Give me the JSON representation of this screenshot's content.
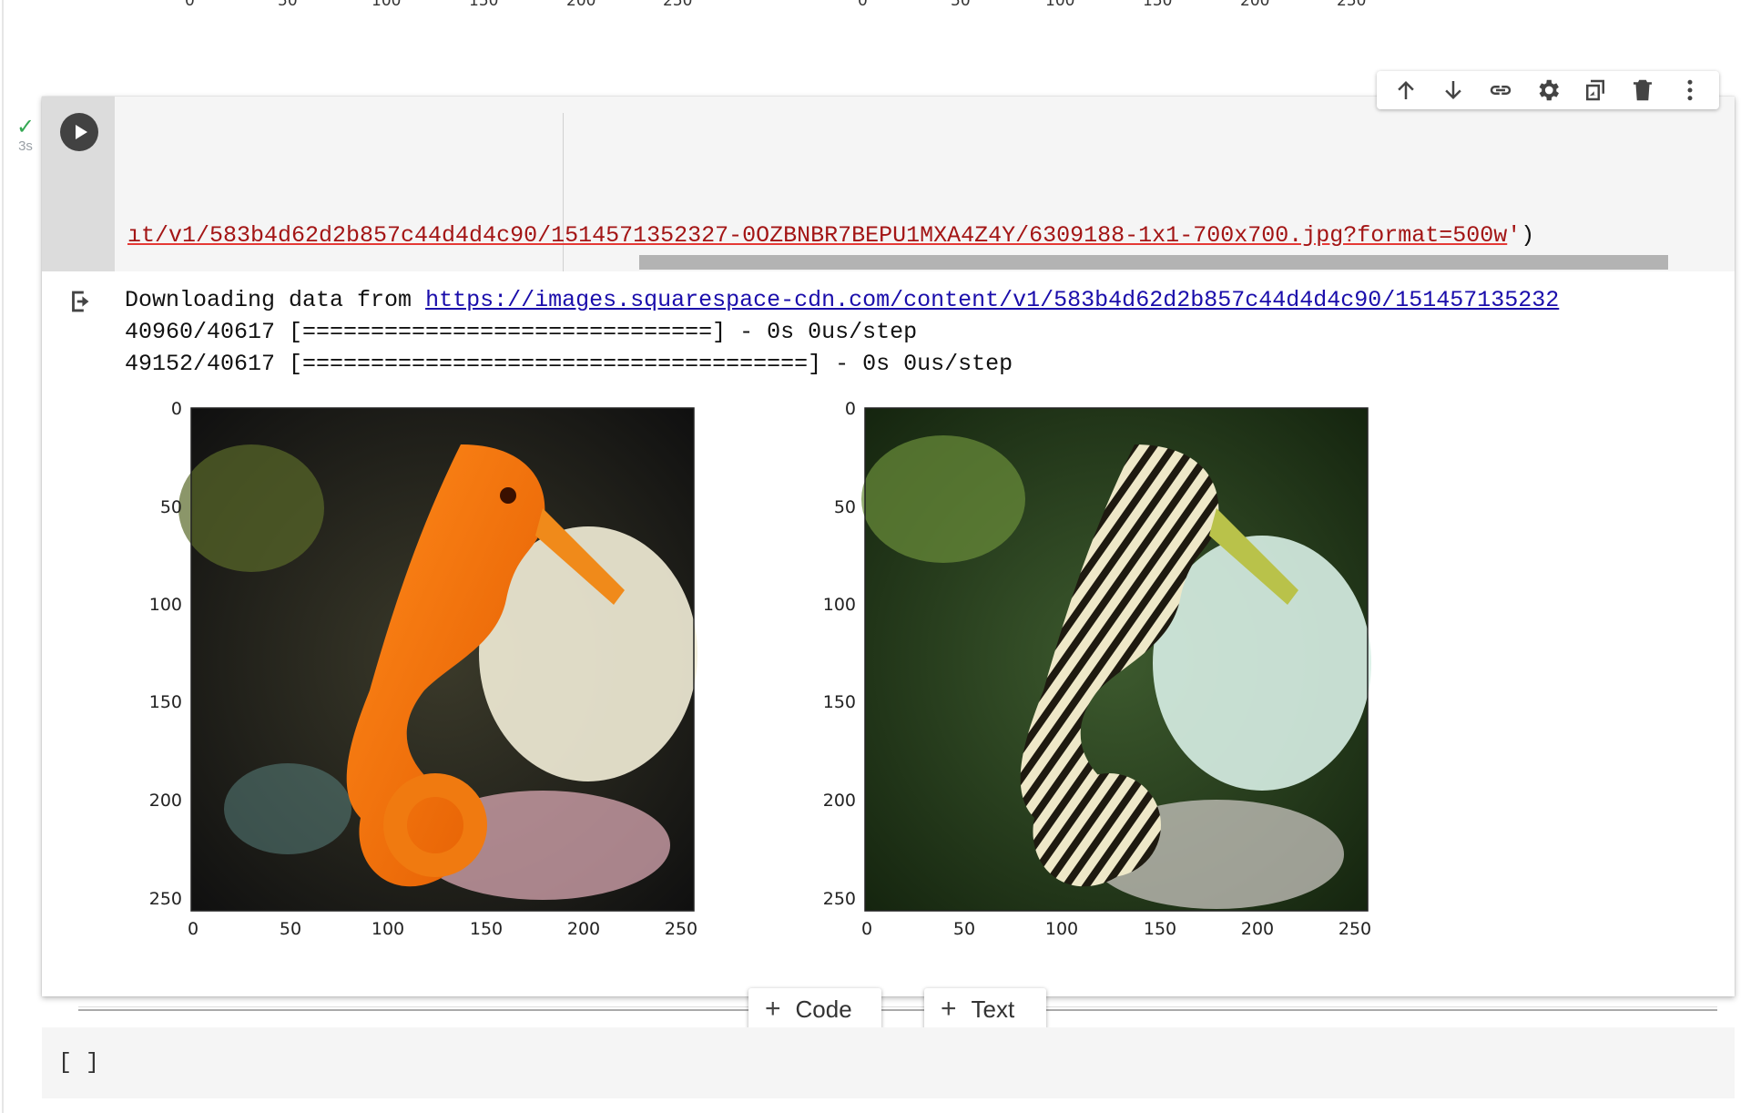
{
  "top_ticks_cut": [
    "0",
    "50",
    "100",
    "150",
    "200",
    "250",
    "0",
    "50",
    "100",
    "150",
    "200",
    "250"
  ],
  "cell": {
    "status_time": "3s",
    "code_tail_prefix": "ıt/v1/583b4d62d2b857c44d4d4c90/1514571352327-0OZBNBR7BEPU1MXA4Z4Y/6309188-1x1-700x700.jpg?format=500w",
    "code_quote": "'",
    "code_close": ")"
  },
  "toolbar": {
    "icons": [
      "arrow-up-icon",
      "arrow-down-icon",
      "link-icon",
      "gear-icon",
      "mirror-cell-icon",
      "delete-icon",
      "more-vert-icon"
    ]
  },
  "output": {
    "download_prefix": "Downloading data from ",
    "download_url": "https://images.squarespace-cdn.com/content/v1/583b4d62d2b857c44d4d4c90/151457135232",
    "progress_1": "40960/40617 [==============================] - 0s 0us/step",
    "progress_2": "49152/40617 [=====================================] - 0s 0us/step"
  },
  "plots": [
    {
      "yticks": [
        "0",
        "50",
        "100",
        "150",
        "200",
        "250"
      ],
      "xticks": [
        "0",
        "50",
        "100",
        "150",
        "200",
        "250"
      ],
      "image": "orange seahorse photo"
    },
    {
      "yticks": [
        "0",
        "50",
        "100",
        "150",
        "200",
        "250"
      ],
      "xticks": [
        "0",
        "50",
        "100",
        "150",
        "200",
        "250"
      ],
      "image": "zebra-striped seahorse (style transfer)"
    }
  ],
  "add_buttons": {
    "code_label": "Code",
    "text_label": "Text"
  },
  "empty_cell": {
    "brackets": "[ ]"
  }
}
